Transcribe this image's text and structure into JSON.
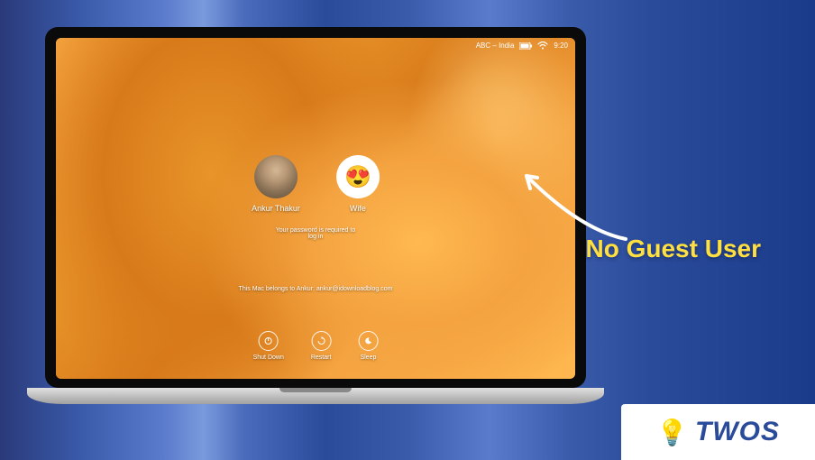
{
  "menubar": {
    "input_label": "ABC – India",
    "battery_icon": "battery-icon",
    "wifi_icon": "wifi-icon",
    "time": "9:20"
  },
  "users": [
    {
      "name": "Ankur Thakur",
      "avatar_kind": "photo"
    },
    {
      "name": "Wife",
      "avatar_kind": "emoji",
      "avatar_emoji": "😍"
    }
  ],
  "login_prompt": "Your password is required to\nlog in",
  "owner_line": "This Mac belongs to Ankur: ankur@idownloadblog.com",
  "system_buttons": [
    {
      "label": "Shut Down",
      "icon": "power-icon"
    },
    {
      "label": "Restart",
      "icon": "restart-icon"
    },
    {
      "label": "Sleep",
      "icon": "sleep-icon"
    }
  ],
  "annotation": {
    "text": "No Guest User"
  },
  "logo": {
    "text": "TWOS"
  }
}
